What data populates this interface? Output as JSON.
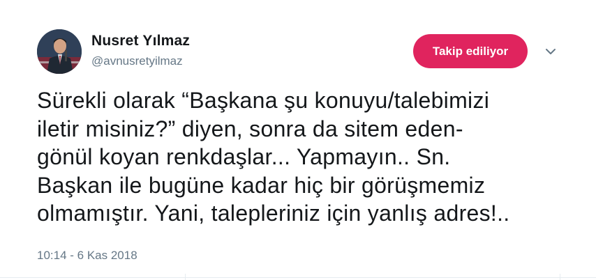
{
  "author": {
    "name": "Nusret Yılmaz",
    "handle": "@avnusretyilmaz",
    "avatar_icon": "profile-photo"
  },
  "follow_button": {
    "label": "Takip ediliyor",
    "color": "#e0245e"
  },
  "menu": {
    "icon": "chevron-down-icon"
  },
  "tweet": {
    "lines": [
      "Sürekli olarak “Başkana şu konuyu/talebimizi",
      "iletir misiniz?” diyen, sonra da sitem eden-",
      "gönül koyan renkdaşlar... Yapmayın.. Sn.",
      "Başkan ile bugüne kadar hiç bir görüşmemiz",
      "olmamıştır. Yani, talepleriniz için yanlış adres!.."
    ],
    "timestamp": "10:14 - 6 Kas 2018"
  }
}
